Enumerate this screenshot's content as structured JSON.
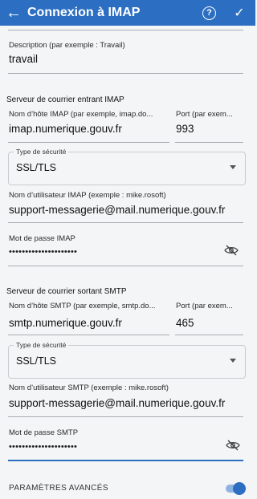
{
  "header": {
    "back_icon": "arrow-left-icon",
    "title": "Connexion à IMAP",
    "help_icon": "help-circle-icon",
    "confirm_icon": "check-icon",
    "color": "#2c6fc2"
  },
  "description": {
    "label": "Description (par exemple : Travail)",
    "value": "travail"
  },
  "incoming": {
    "section_title": "Serveur de courrier entrant IMAP",
    "host_label": "Nom d’hôte IMAP (par exemple, imap.do...",
    "host_value": "imap.numerique.gouv.fr",
    "port_label": "Port (par exem...",
    "port_value": "993",
    "security_label": "Type de sécurité",
    "security_value": "SSL/TLS",
    "username_label": "Nom d’utilisateur IMAP (exemple : mike.rosoft)",
    "username_value": "support-messagerie@mail.numerique.gouv.fr",
    "password_label": "Mot de passe IMAP",
    "password_value": "•••••••••••••••••••••"
  },
  "outgoing": {
    "section_title": "Serveur de courrier sortant SMTP",
    "host_label": "Nom d’hôte SMTP (par exemple, smtp.do...",
    "host_value": "smtp.numerique.gouv.fr",
    "port_label": "Port (par exem...",
    "port_value": "465",
    "security_label": "Type de sécurité",
    "security_value": "SSL/TLS",
    "username_label": "Nom d’utilisateur SMTP (exemple : mike.rosoft)",
    "username_value": "support-messagerie@mail.numerique.gouv.fr",
    "password_label": "Mot de passe SMTP",
    "password_value": "•••••••••••••••••••••"
  },
  "advanced": {
    "label": "PARAMÈTRES AVANCÉS",
    "toggle_on": true
  }
}
